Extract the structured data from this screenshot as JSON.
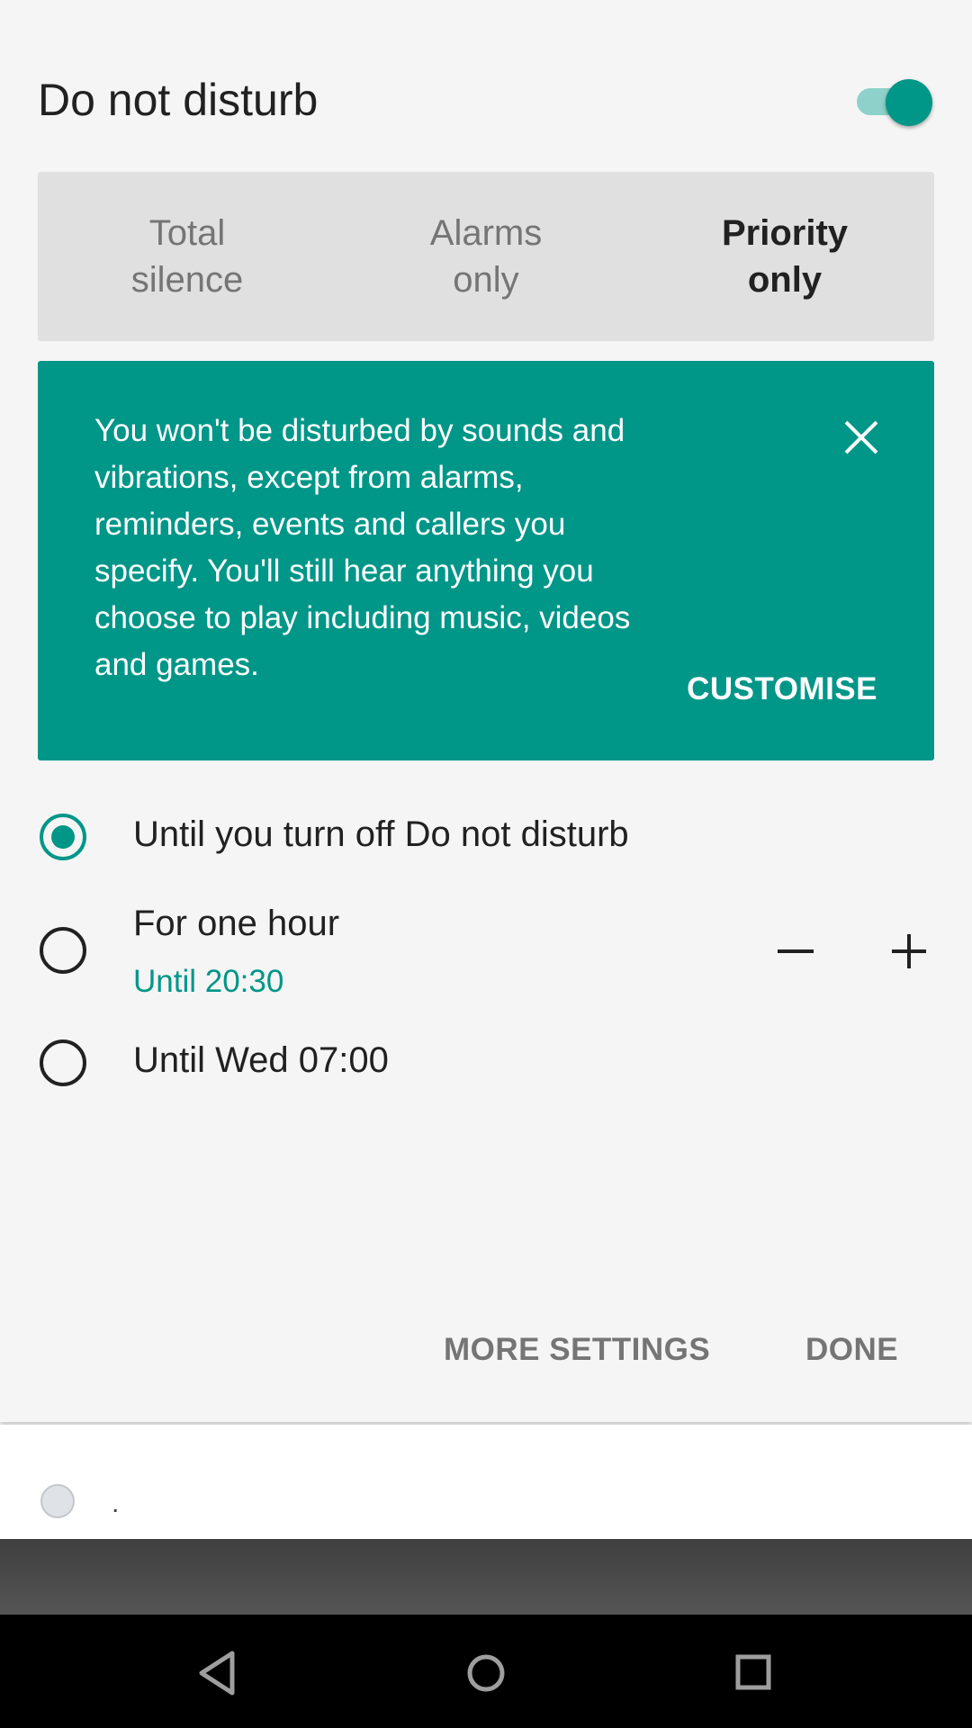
{
  "dnd": {
    "title": "Do not disturb",
    "toggle_on": true,
    "accent_color": "#009688"
  },
  "modes": [
    {
      "label": "Total\nsilence",
      "selected": false
    },
    {
      "label": "Alarms\nonly",
      "selected": false
    },
    {
      "label": "Priority\nonly",
      "selected": true
    }
  ],
  "info_card": {
    "text": "You won't be disturbed by sounds and vibrations, except from alarms, reminders, events and callers you specify. You'll still hear anything you choose to play including music, videos and games.",
    "action_label": "CUSTOMISE",
    "close_icon": "close-icon"
  },
  "duration_options": [
    {
      "label": "Until you turn off Do not disturb",
      "checked": true
    },
    {
      "label": "For one hour",
      "sublabel": "Until 20:30",
      "checked": false
    },
    {
      "label": "Until Wed 07:00",
      "checked": false
    }
  ],
  "footer": {
    "more_settings_label": "MORE SETTINGS",
    "done_label": "DONE"
  },
  "notification": {
    "text": "."
  },
  "nav_bar": {
    "back_icon": "back-triangle-icon",
    "home_icon": "home-circle-icon",
    "recents_icon": "recents-square-icon"
  }
}
